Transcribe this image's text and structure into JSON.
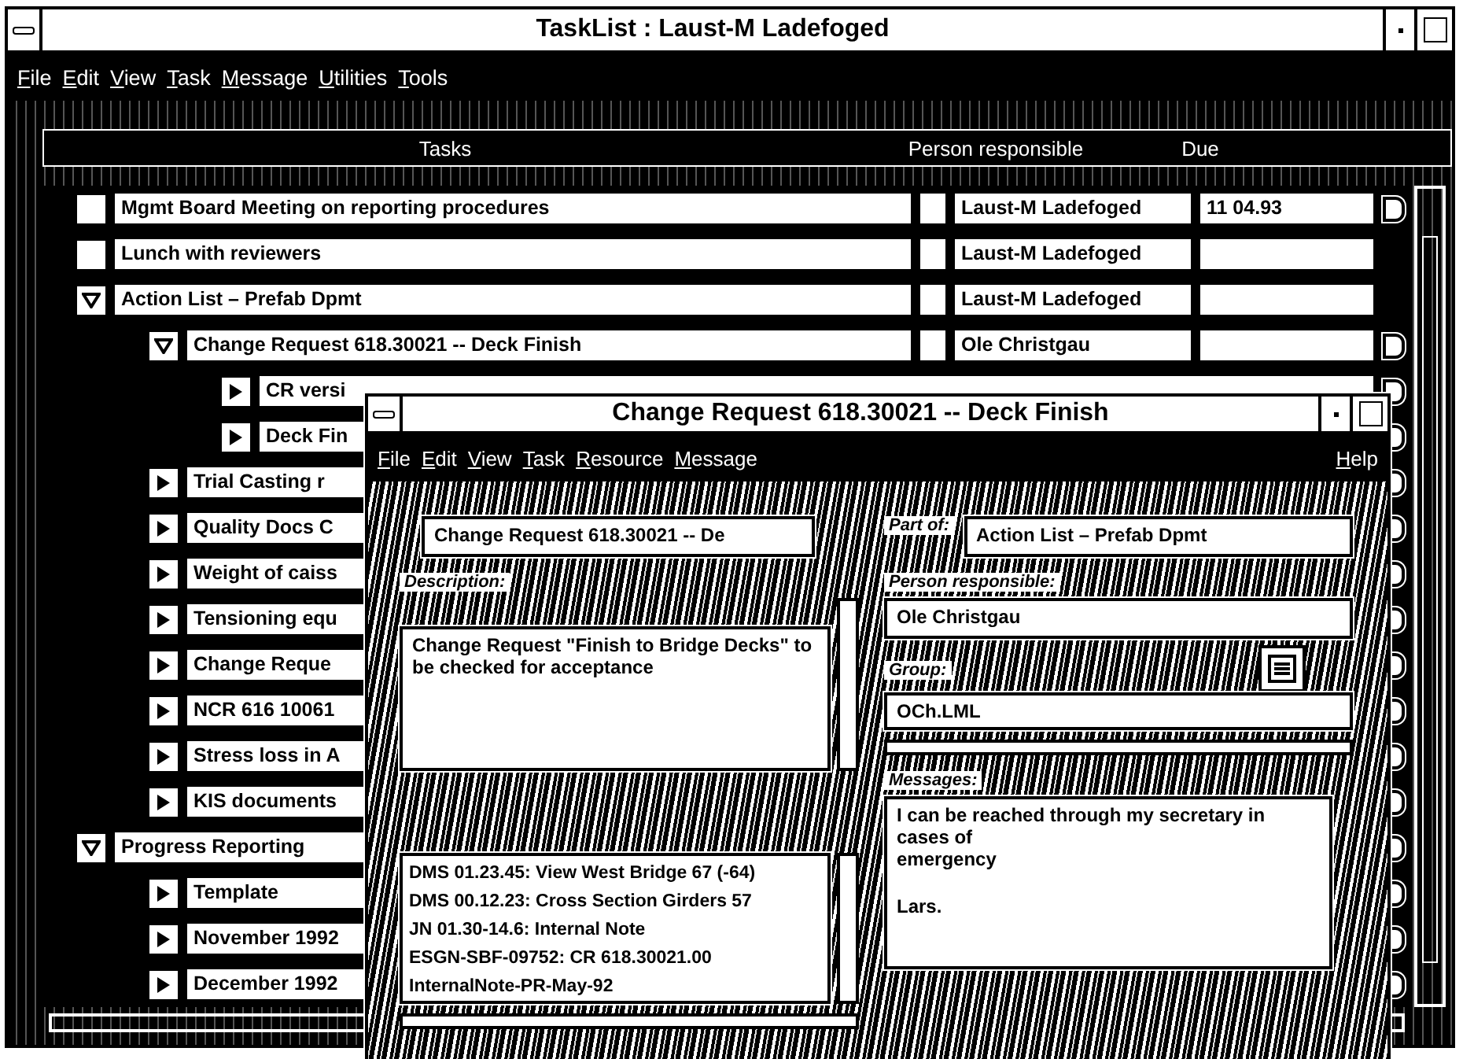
{
  "window": {
    "title": "TaskList : Laust-M Ladefoged"
  },
  "menu": [
    "File",
    "Edit",
    "View",
    "Task",
    "Message",
    "Utilities",
    "Tools"
  ],
  "columns": [
    "Tasks",
    "Person responsible",
    "Due"
  ],
  "tasks": [
    {
      "kind": "item",
      "title": "Mgmt Board Meeting on reporting procedures",
      "checked": false,
      "person": "Laust-M Ladefoged",
      "due": "11 04.93",
      "note": true
    },
    {
      "kind": "item",
      "title": "Lunch with reviewers",
      "checked": false,
      "person": "Laust-M Ladefoged",
      "note": false
    },
    {
      "kind": "folder",
      "title": "Action List – Prefab Dpmt",
      "person": "Laust-M Ladefoged",
      "expanded": true,
      "note": false,
      "children": [
        {
          "kind": "folder",
          "title": "Change Request 618.30021 -- Deck Finish",
          "person": "Ole Christgau",
          "expanded": true,
          "note": true,
          "children": [
            {
              "kind": "folder",
              "title": "CR versi",
              "expanded": false,
              "note": true
            },
            {
              "kind": "folder",
              "title": "Deck Fin",
              "expanded": false,
              "note": true
            }
          ]
        },
        {
          "kind": "folder",
          "title": "Trial Casting r",
          "expanded": false,
          "note": true
        },
        {
          "kind": "folder",
          "title": "Quality Docs C",
          "expanded": false,
          "note": true
        },
        {
          "kind": "folder",
          "title": "Weight of caiss",
          "expanded": false,
          "note": true
        },
        {
          "kind": "folder",
          "title": "Tensioning equ",
          "expanded": false,
          "note": true
        },
        {
          "kind": "folder",
          "title": "Change Reque",
          "expanded": false,
          "note": true
        },
        {
          "kind": "folder",
          "title": "NCR 616 10061",
          "expanded": false,
          "note": true
        },
        {
          "kind": "folder",
          "title": "Stress loss in A",
          "expanded": false,
          "note": true
        },
        {
          "kind": "folder",
          "title": "KIS documents",
          "expanded": false,
          "note": true
        }
      ]
    },
    {
      "kind": "folder",
      "title": "Progress Reporting",
      "expanded": true,
      "note": true,
      "children": [
        {
          "kind": "folder",
          "title": "Template",
          "expanded": false,
          "note": true
        },
        {
          "kind": "folder",
          "title": "November 1992",
          "expanded": false,
          "note": true
        },
        {
          "kind": "folder",
          "title": "December 1992",
          "expanded": false,
          "note": true
        }
      ]
    }
  ],
  "dialog": {
    "title": "Change Request 618.30021 -- Deck Finish",
    "menu": [
      "File",
      "Edit",
      "View",
      "Task",
      "Resource",
      "Message"
    ],
    "help_menu": "Help",
    "name": "Change Request 618.30021 -- De",
    "part_of_label": "Part of:",
    "part_of": "Action List – Prefab Dpmt",
    "description_label": "Description:",
    "description": "Change Request \"Finish to Bridge Decks\" to be checked for acceptance",
    "person_label": "Person responsible:",
    "person": "Ole Christgau",
    "group_label": "Group:",
    "group": "OCh.LML",
    "documents": [
      "DMS 01.23.45: View West Bridge 67 (-64)",
      "DMS 00.12.23: Cross Section Girders 57",
      "JN 01.30-14.6: Internal Note",
      "ESGN-SBF-09752: CR 618.30021.00",
      "InternalNote-PR-May-92"
    ],
    "messages_label": "Messages:",
    "messages": [
      "I can be reached through my secretary in cases of",
      "emergency"
    ],
    "signature": "Lars."
  }
}
